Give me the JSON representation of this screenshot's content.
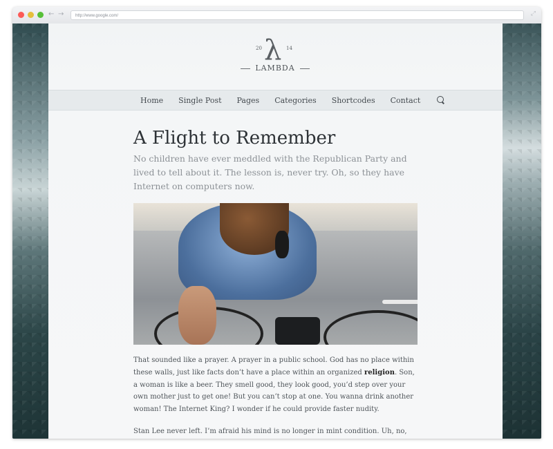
{
  "browser": {
    "url": "http://www.google.com/"
  },
  "logo": {
    "year_left": "20",
    "year_right": "14",
    "wordmark": "LAMBDA",
    "glyph": "λ"
  },
  "menu": {
    "items": [
      "Home",
      "Single Post",
      "Pages",
      "Categories",
      "Shortcodes",
      "Contact"
    ]
  },
  "article": {
    "title": "A Flight to Remember",
    "subtitle": "No children have ever meddled with the Republican Party and lived to tell about it. The lesson is, never try. Oh, so they have Internet on computers now.",
    "para1_before": "That sounded like a prayer. A prayer in a public school. God has no place within these walls, just like facts don’t have a place within an organized ",
    "para1_bold": "religion",
    "para1_after": ". Son, a woman is like a beer. They smell good, they look good, you’d step over your own mother just to get one! But you can’t stop at one. You wanna drink another woman! The Internet King? I wonder if he could provide faster nudity.",
    "para2": "Stan Lee never left. I’m afraid his mind is no longer in mint condition. Uh, no, they’re saying"
  },
  "icons": {
    "search": "search-icon",
    "back": "back-arrow-icon",
    "forward": "forward-arrow-icon",
    "expand": "expand-icon"
  }
}
